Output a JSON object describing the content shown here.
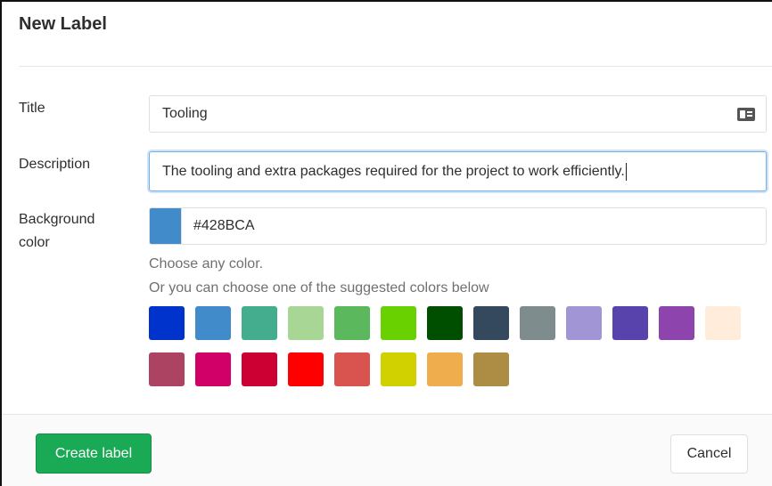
{
  "header": {
    "title": "New Label"
  },
  "form": {
    "title_label": "Title",
    "title_value": "Tooling",
    "description_label": "Description",
    "description_value": "The tooling and extra packages required for the project to work efficiently.",
    "bg_label_line1": "Background",
    "bg_label_line2": "color",
    "bg_color_value": "#428BCA",
    "help_line1": "Choose any color.",
    "help_line2": "Or you can choose one of the suggested colors below"
  },
  "swatches": [
    "#0033cc",
    "#428bca",
    "#44ad8e",
    "#a8d695",
    "#5cb85c",
    "#69d100",
    "#004e00",
    "#34495e",
    "#7f8c8d",
    "#a295d6",
    "#5843ad",
    "#8e44ad",
    "#ffecdb",
    "#ad4363",
    "#d10069",
    "#cc0033",
    "#ff0000",
    "#d9534f",
    "#d1d100",
    "#f0ad4e",
    "#ad8d43"
  ],
  "footer": {
    "create_label": "Create label",
    "cancel_label": "Cancel"
  },
  "colors": {
    "primary_green": "#1aaa55",
    "focus_blue": "#73afea",
    "selected_color": "#428BCA"
  }
}
